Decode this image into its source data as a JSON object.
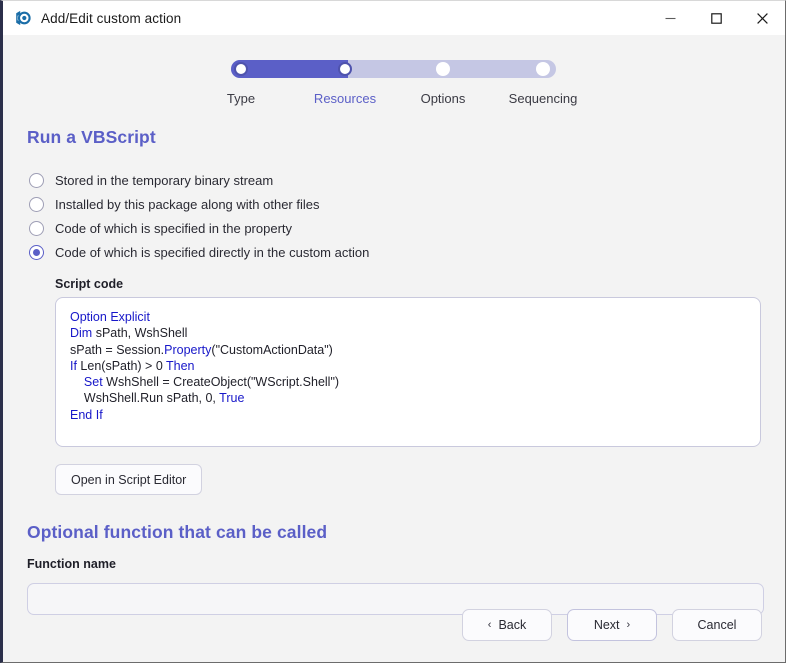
{
  "window": {
    "title": "Add/Edit custom action",
    "app_icon": "app-logo-icon",
    "minimize": "minimize-icon",
    "maximize": "maximize-icon",
    "close": "close-icon"
  },
  "stepper": {
    "steps": [
      {
        "label": "Type",
        "state": "completed"
      },
      {
        "label": "Resources",
        "state": "current"
      },
      {
        "label": "Options",
        "state": "upcoming"
      },
      {
        "label": "Sequencing",
        "state": "upcoming"
      }
    ],
    "active_color": "#5b5fc7",
    "track_color": "#c5c7e4"
  },
  "main": {
    "heading": "Run a VBScript",
    "radio_options": [
      {
        "label": "Stored in the temporary binary stream",
        "selected": false
      },
      {
        "label": "Installed by this package along with other files",
        "selected": false
      },
      {
        "label": "Code of which is specified in the property",
        "selected": false
      },
      {
        "label": "Code of which is specified directly in the custom action",
        "selected": true
      }
    ],
    "script_code_label": "Script code",
    "script_code_lines": [
      "Option Explicit",
      "Dim sPath, WshShell",
      "sPath = Session.Property(\"CustomActionData\")",
      "If Len(sPath) > 0 Then",
      "    Set WshShell = CreateObject(\"WScript.Shell\")",
      "    WshShell.Run sPath, 0, True",
      "End If"
    ],
    "open_editor_button": "Open in Script Editor",
    "optional_heading": "Optional function that can be called",
    "function_name_label": "Function name",
    "function_name_value": "",
    "function_name_placeholder": ""
  },
  "footer": {
    "back": "Back",
    "next": "Next",
    "cancel": "Cancel",
    "back_chevron": "‹",
    "next_chevron": "›"
  }
}
